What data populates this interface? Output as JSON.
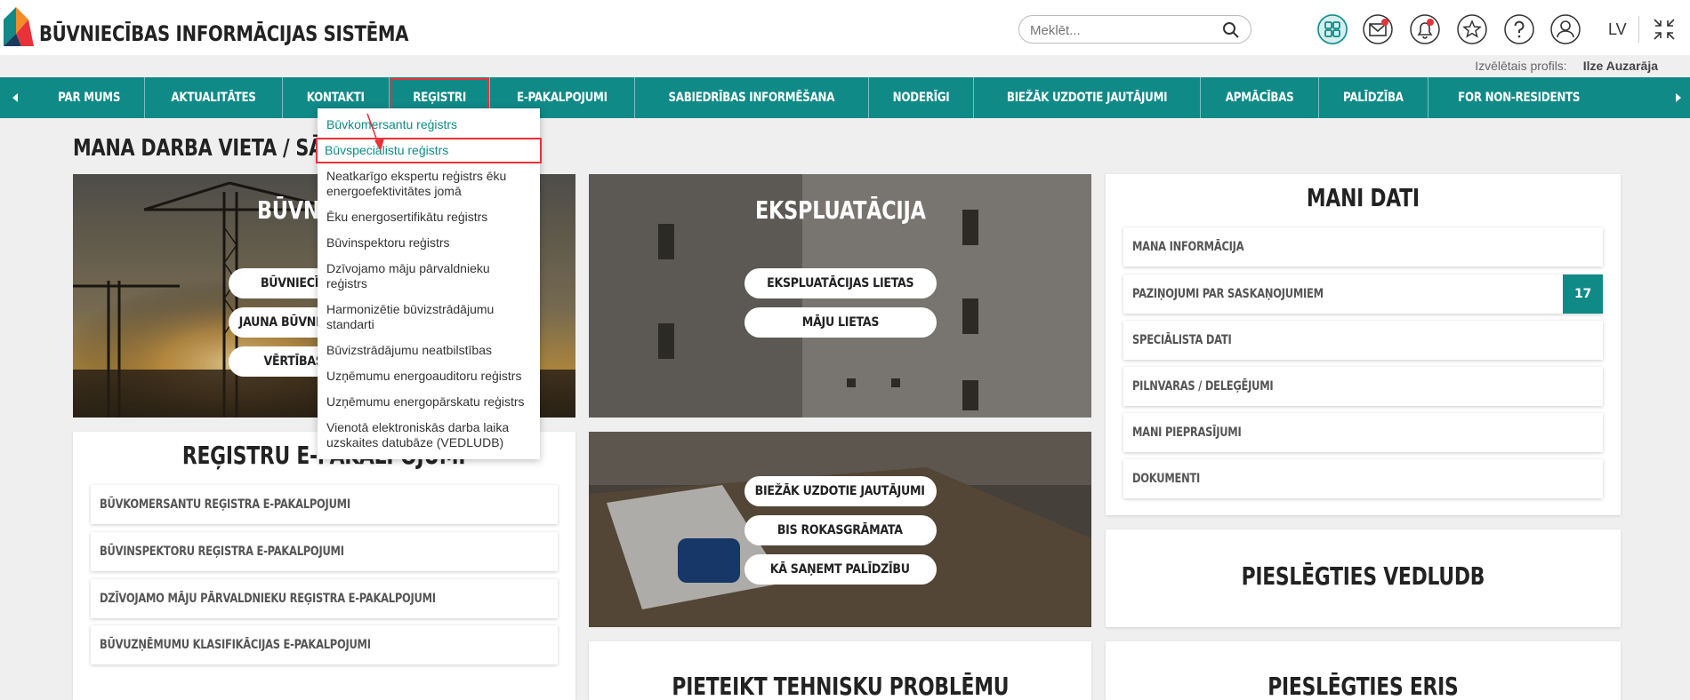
{
  "header": {
    "brand": "BŪVNIECĪBAS INFORMĀCIJAS SISTĒMA",
    "search_placeholder": "Meklēt...",
    "icons": [
      "apps-grid-icon",
      "mail-icon",
      "notifications-bell-icon",
      "favorites-star-icon",
      "help-icon",
      "user-icon"
    ],
    "language": "LV",
    "profile_label": "Izvēlētais profils:",
    "profile_name": "Ilze Auzarāja",
    "accent": "#0f8a87"
  },
  "nav": {
    "items": [
      "PAR MUMS",
      "AKTUALITĀTES",
      "KONTAKTI",
      "REĢISTRI",
      "E-PAKALPOJUMI",
      "SABIEDRĪBAS INFORMĒŠANA",
      "NODERĪGI",
      "BIEŽĀK UZDOTIE JAUTĀJUMI",
      "APMĀCĪBAS",
      "PALĪDZĪBA",
      "FOR NON-RESIDENTS"
    ],
    "active": "REĢISTRI"
  },
  "dropdown": {
    "items": [
      "Būvkomersantu reģistrs",
      "Būvspeciālistu reģistrs",
      "Neatkarīgo ekspertu reģistrs ēku energoefektivitātes jomā",
      "Ēku energosertifikātu reģistrs",
      "Būvinspektoru reģistrs",
      "Dzīvojamo māju pārvaldnieku reģistrs",
      "Harmonizētie būvizstrādājumu standarti",
      "Būvizstrādājumu neatbilstības",
      "Uzņēmumu energoauditoru reģistrs",
      "Uzņēmumu energopārskatu reģistrs",
      "Vienotā elektroniskās darba laika uzskaites datubāze (VEDLUDB)"
    ]
  },
  "page": {
    "title": "MANA DARBA VIETA / SĀKUMS"
  },
  "tiles": {
    "buvnieciba": {
      "title": "BŪVNIECĪBA",
      "buttons": [
        "BŪVNIECĪBAS LIETAS",
        "JAUNA BŪVNIECĪBAS IECERE",
        "VĒRTĪBAS APRĒĶINI"
      ]
    },
    "ekspluatacija": {
      "title": "EKSPLUATĀCIJA",
      "buttons": [
        "EKSPLUATĀCIJAS LIETAS",
        "MĀJU LIETAS"
      ]
    },
    "help": {
      "buttons": [
        "BIEŽĀK UZDOTIE JAUTĀJUMI",
        "BIS ROKASGRĀMATA",
        "KĀ SAŅEMT PALĪDZĪBU"
      ]
    }
  },
  "registri_card": {
    "title": "REĢISTRU E-PAKALPOJUMI",
    "rows": [
      "BŪVKOMERSANTU REĢISTRA E-PAKALPOJUMI",
      "BŪVINSPEKTORU REĢISTRA E-PAKALPOJUMI",
      "DZĪVOJAMO MĀJU PĀRVALDNIEKU REĢISTRA E-PAKALPOJUMI",
      "BŪVUZŅĒMUMU KLASIFIKĀCIJAS E-PAKALPOJUMI"
    ]
  },
  "mani_dati": {
    "title": "MANI DATI",
    "rows": [
      "MANA INFORMĀCIJA",
      "PAZIŅOJUMI PAR SASKAŅOJUMIEM",
      "SPECIĀLISTA DATI",
      "PILNVARAS / DELEĢĒJUMI",
      "MANI PIEPRASĪJUMI",
      "DOKUMENTI"
    ],
    "badge": "17"
  },
  "vedludb": {
    "title": "PIESLĒGTIES VEDLUDB"
  },
  "tech": {
    "title": "PIETEIKT TEHNISKU PROBLĒMU"
  },
  "eris": {
    "title": "PIESLĒGTIES ERIS"
  }
}
